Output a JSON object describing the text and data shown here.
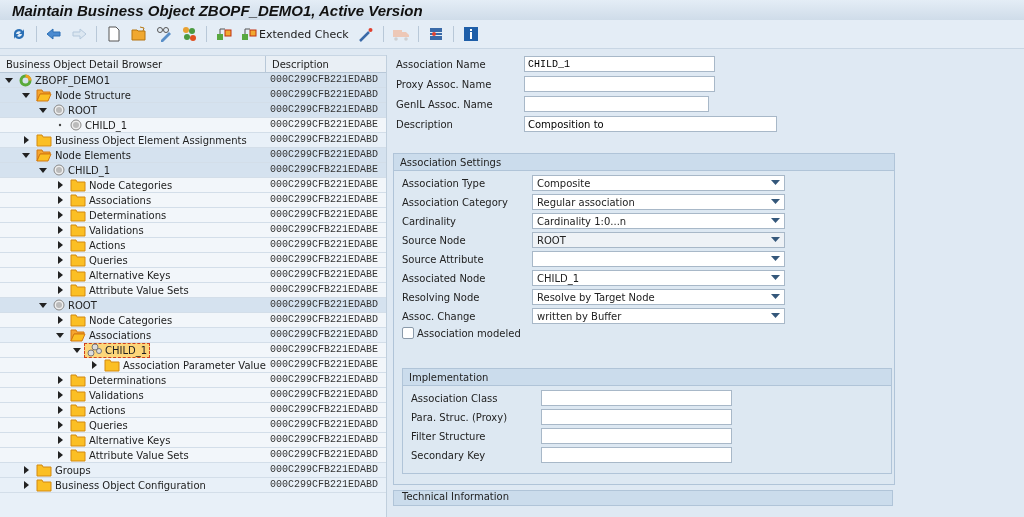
{
  "window": {
    "title": "Maintain Business Object ZBOPF_DEMO1, Active Version"
  },
  "toolbar": [
    {
      "kind": "refresh",
      "disabled": false
    },
    {
      "kind": "back",
      "disabled": false
    },
    {
      "kind": "forward",
      "disabled": true
    },
    {
      "kind": "new",
      "disabled": false
    },
    {
      "kind": "open",
      "disabled": false
    },
    {
      "kind": "display",
      "disabled": false
    },
    {
      "kind": "nodes",
      "disabled": false
    },
    {
      "kind": "check",
      "disabled": false
    },
    {
      "kind": "check",
      "disabled": false,
      "label": "Extended Check"
    },
    {
      "kind": "wand",
      "disabled": false
    },
    {
      "kind": "truck",
      "disabled": true
    },
    {
      "kind": "layout",
      "disabled": false
    },
    {
      "kind": "info",
      "disabled": false
    }
  ],
  "tree": {
    "columns": [
      "Business Object Detail Browser",
      "Description"
    ],
    "nodes": [
      {
        "label": "ZBOPF_DEMO1",
        "description": "000C299CFB221EDABD",
        "kind": "object",
        "expanded": true,
        "selected": false,
        "children": [
          {
            "label": "Node Structure",
            "description": "000C299CFB221EDABD",
            "kind": "folder",
            "expanded": true,
            "selected": false,
            "children": [
              {
                "label": "ROOT",
                "description": "000C299CFB221EDABD",
                "kind": "node",
                "expanded": true,
                "selected": false,
                "children": [
                  {
                    "label": "CHILD_1",
                    "description": "000C299CFB221EDABE",
                    "kind": "node",
                    "selected": false
                  }
                ]
              }
            ]
          },
          {
            "label": "Business Object Element Assignments",
            "description": "000C299CFB221EDABD",
            "kind": "folder",
            "expanded": false,
            "selected": false
          },
          {
            "label": "Node Elements",
            "description": "000C299CFB221EDABD",
            "kind": "folder",
            "expanded": true,
            "selected": false,
            "children": [
              {
                "label": "CHILD_1",
                "description": "000C299CFB221EDABE",
                "kind": "node",
                "expanded": true,
                "selected": false,
                "children": [
                  {
                    "label": "Node Categories",
                    "description": "000C299CFB221EDABE",
                    "kind": "folder",
                    "expanded": false,
                    "selected": false
                  },
                  {
                    "label": "Associations",
                    "description": "000C299CFB221EDABE",
                    "kind": "folder",
                    "expanded": false,
                    "selected": false
                  },
                  {
                    "label": "Determinations",
                    "description": "000C299CFB221EDABE",
                    "kind": "folder",
                    "expanded": false,
                    "selected": false
                  },
                  {
                    "label": "Validations",
                    "description": "000C299CFB221EDABE",
                    "kind": "folder",
                    "expanded": false,
                    "selected": false
                  },
                  {
                    "label": "Actions",
                    "description": "000C299CFB221EDABE",
                    "kind": "folder",
                    "expanded": false,
                    "selected": false
                  },
                  {
                    "label": "Queries",
                    "description": "000C299CFB221EDABE",
                    "kind": "folder",
                    "expanded": false,
                    "selected": false
                  },
                  {
                    "label": "Alternative Keys",
                    "description": "000C299CFB221EDABE",
                    "kind": "folder",
                    "expanded": false,
                    "selected": false
                  },
                  {
                    "label": "Attribute Value Sets",
                    "description": "000C299CFB221EDABE",
                    "kind": "folder",
                    "expanded": false,
                    "selected": false
                  }
                ]
              },
              {
                "label": "ROOT",
                "description": "000C299CFB221EDABD",
                "kind": "node",
                "expanded": true,
                "selected": false,
                "children": [
                  {
                    "label": "Node Categories",
                    "description": "000C299CFB221EDABD",
                    "kind": "folder",
                    "expanded": false,
                    "selected": false
                  },
                  {
                    "label": "Associations",
                    "description": "000C299CFB221EDABD",
                    "kind": "folder",
                    "expanded": true,
                    "selected": false,
                    "children": [
                      {
                        "label": "CHILD_1",
                        "description": "000C299CFB221EDABE",
                        "kind": "association",
                        "expanded": true,
                        "selected": true,
                        "children": [
                          {
                            "label": "Association Parameter Value",
                            "description": "000C299CFB221EDABE",
                            "kind": "folder",
                            "expanded": false,
                            "selected": false
                          }
                        ]
                      }
                    ]
                  },
                  {
                    "label": "Determinations",
                    "description": "000C299CFB221EDABD",
                    "kind": "folder",
                    "expanded": false,
                    "selected": false
                  },
                  {
                    "label": "Validations",
                    "description": "000C299CFB221EDABD",
                    "kind": "folder",
                    "expanded": false,
                    "selected": false
                  },
                  {
                    "label": "Actions",
                    "description": "000C299CFB221EDABD",
                    "kind": "folder",
                    "expanded": false,
                    "selected": false
                  },
                  {
                    "label": "Queries",
                    "description": "000C299CFB221EDABD",
                    "kind": "folder",
                    "expanded": false,
                    "selected": false
                  },
                  {
                    "label": "Alternative Keys",
                    "description": "000C299CFB221EDABD",
                    "kind": "folder",
                    "expanded": false,
                    "selected": false
                  },
                  {
                    "label": "Attribute Value Sets",
                    "description": "000C299CFB221EDABD",
                    "kind": "folder",
                    "expanded": false,
                    "selected": false
                  }
                ]
              }
            ]
          },
          {
            "label": "Groups",
            "description": "000C299CFB221EDABD",
            "kind": "folder",
            "expanded": false,
            "selected": false
          },
          {
            "label": "Business Object Configuration",
            "description": "000C299CFB221EDABD",
            "kind": "folder",
            "expanded": false,
            "selected": false
          }
        ]
      }
    ]
  },
  "header_fields": [
    {
      "label": "Association Name",
      "value": "CHILD_1"
    },
    {
      "label": "Proxy Assoc. Name"
    },
    {
      "label": "GenIL Assoc. Name"
    },
    {
      "label": "Description",
      "value": "Composition to"
    }
  ],
  "association_settings": {
    "title": "Association Settings",
    "fields": [
      {
        "label": "Association Type",
        "value": "Composite",
        "disabled": false
      },
      {
        "label": "Association Category",
        "value": "Regular association",
        "disabled": false
      },
      {
        "label": "Cardinality",
        "value": "Cardinality 1:0...n",
        "disabled": false
      },
      {
        "label": "Source Node",
        "value": "ROOT",
        "disabled": true
      },
      {
        "label": "Source Attribute",
        "disabled": false
      },
      {
        "label": "Associated Node",
        "value": "CHILD_1",
        "disabled": false
      },
      {
        "label": "Resolving Node",
        "value": "Resolve by Target Node",
        "disabled": false
      },
      {
        "label": "Assoc. Change",
        "value": "written by Buffer",
        "disabled": false
      }
    ],
    "checkbox": {
      "label": "Association modeled",
      "checked": false
    },
    "implementation": {
      "title": "Implementation",
      "fields": [
        {
          "label": "Association Class"
        },
        {
          "label": "Para. Struc. (Proxy)"
        },
        {
          "label": "Filter Structure"
        },
        {
          "label": "Secondary Key"
        }
      ]
    }
  },
  "technical_information": {
    "title": "Technical Information"
  }
}
